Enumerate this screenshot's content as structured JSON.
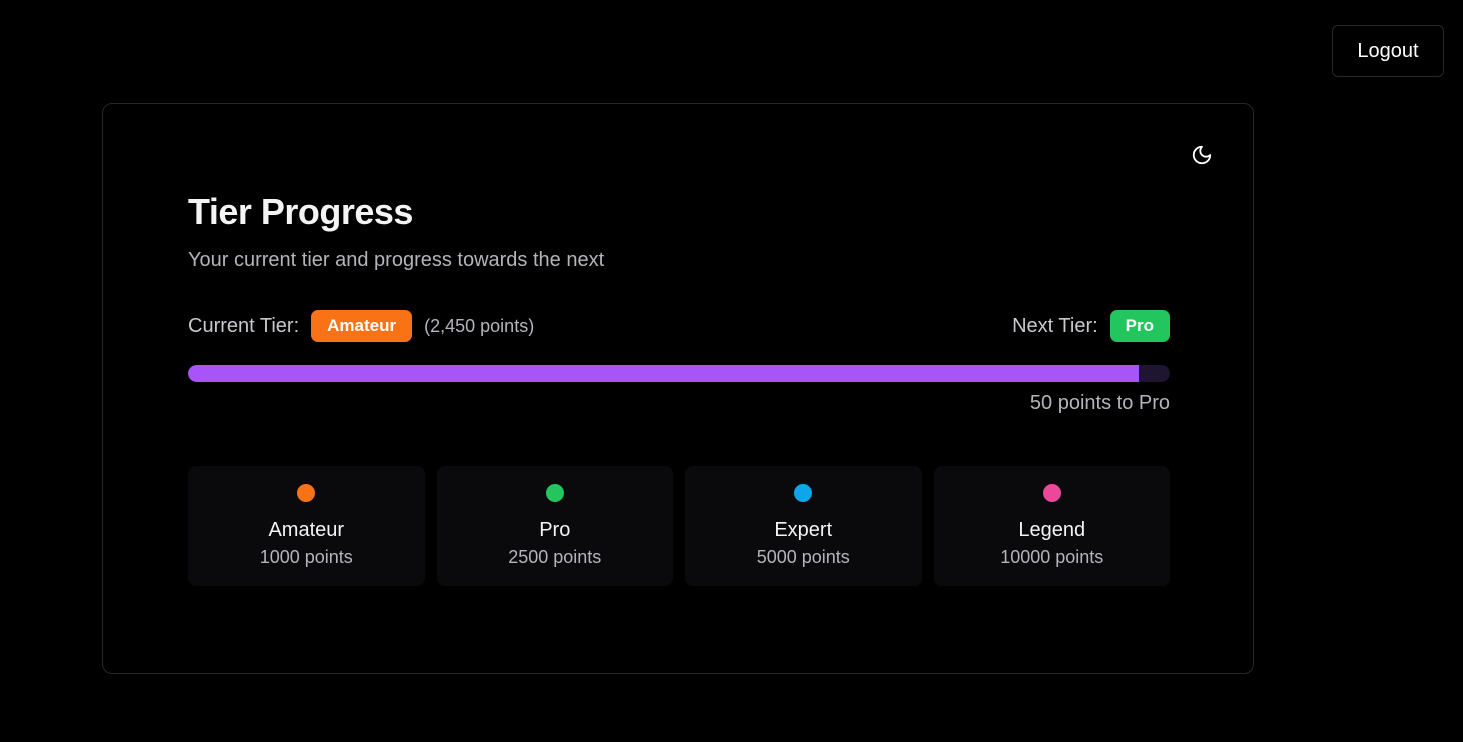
{
  "header": {
    "logout_label": "Logout"
  },
  "card": {
    "theme_icon": "moon-icon",
    "title": "Tier Progress",
    "subtitle": "Your current tier and progress towards the next",
    "current_tier_label": "Current Tier:",
    "current_tier": "Amateur",
    "current_points_note": "(2,450 points)",
    "next_tier_label": "Next Tier:",
    "next_tier": "Pro",
    "progress_fraction": 0.968,
    "remaining_text": "50 points to Pro",
    "colors": {
      "current_badge": "#f97316",
      "next_badge": "#22c55e",
      "progress_fill": "#a855f7"
    }
  },
  "tiers": [
    {
      "name": "Amateur",
      "points": "1000 points",
      "color": "#f97316"
    },
    {
      "name": "Pro",
      "points": "2500 points",
      "color": "#22c55e"
    },
    {
      "name": "Expert",
      "points": "5000 points",
      "color": "#0ea5e9"
    },
    {
      "name": "Legend",
      "points": "10000 points",
      "color": "#ec4899"
    }
  ]
}
